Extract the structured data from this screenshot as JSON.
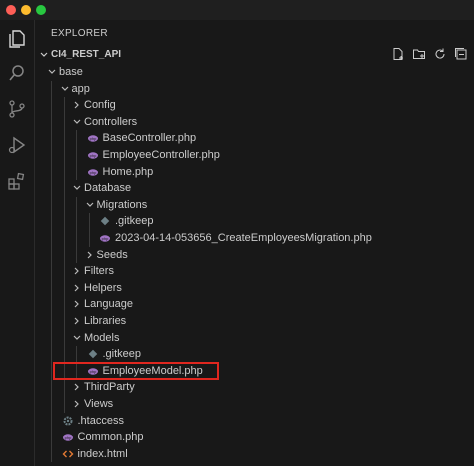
{
  "explorer": {
    "title": "EXPLORER",
    "section_title": "CI4_REST_API",
    "actions": [
      "new-file-icon",
      "new-folder-icon",
      "refresh-icon",
      "collapse-all-icon"
    ]
  },
  "colors": {
    "php_icon": "#a074c4",
    "gitkeep_icon": "#6d8086",
    "htaccess_icon": "#6d8086",
    "html_icon": "#e37933",
    "highlight": "#e0271f"
  },
  "tree": [
    {
      "label": "base",
      "depth": 0,
      "type": "folder",
      "expanded": true
    },
    {
      "label": "app",
      "depth": 1,
      "type": "folder",
      "expanded": true
    },
    {
      "label": "Config",
      "depth": 2,
      "type": "folder",
      "expanded": false
    },
    {
      "label": "Controllers",
      "depth": 2,
      "type": "folder",
      "expanded": true
    },
    {
      "label": "BaseController.php",
      "depth": 3,
      "type": "php"
    },
    {
      "label": "EmployeeController.php",
      "depth": 3,
      "type": "php"
    },
    {
      "label": "Home.php",
      "depth": 3,
      "type": "php"
    },
    {
      "label": "Database",
      "depth": 2,
      "type": "folder",
      "expanded": true
    },
    {
      "label": "Migrations",
      "depth": 3,
      "type": "folder",
      "expanded": true
    },
    {
      "label": ".gitkeep",
      "depth": 4,
      "type": "gitkeep"
    },
    {
      "label": "2023-04-14-053656_CreateEmployeesMigration.php",
      "depth": 4,
      "type": "php"
    },
    {
      "label": "Seeds",
      "depth": 3,
      "type": "folder",
      "expanded": false
    },
    {
      "label": "Filters",
      "depth": 2,
      "type": "folder",
      "expanded": false
    },
    {
      "label": "Helpers",
      "depth": 2,
      "type": "folder",
      "expanded": false
    },
    {
      "label": "Language",
      "depth": 2,
      "type": "folder",
      "expanded": false
    },
    {
      "label": "Libraries",
      "depth": 2,
      "type": "folder",
      "expanded": false
    },
    {
      "label": "Models",
      "depth": 2,
      "type": "folder",
      "expanded": true
    },
    {
      "label": ".gitkeep",
      "depth": 3,
      "type": "gitkeep"
    },
    {
      "label": "EmployeeModel.php",
      "depth": 3,
      "type": "php",
      "highlighted": true
    },
    {
      "label": "ThirdParty",
      "depth": 2,
      "type": "folder",
      "expanded": false
    },
    {
      "label": "Views",
      "depth": 2,
      "type": "folder",
      "expanded": false
    },
    {
      "label": ".htaccess",
      "depth": 1,
      "type": "htaccess"
    },
    {
      "label": "Common.php",
      "depth": 1,
      "type": "php"
    },
    {
      "label": "index.html",
      "depth": 1,
      "type": "html"
    }
  ]
}
